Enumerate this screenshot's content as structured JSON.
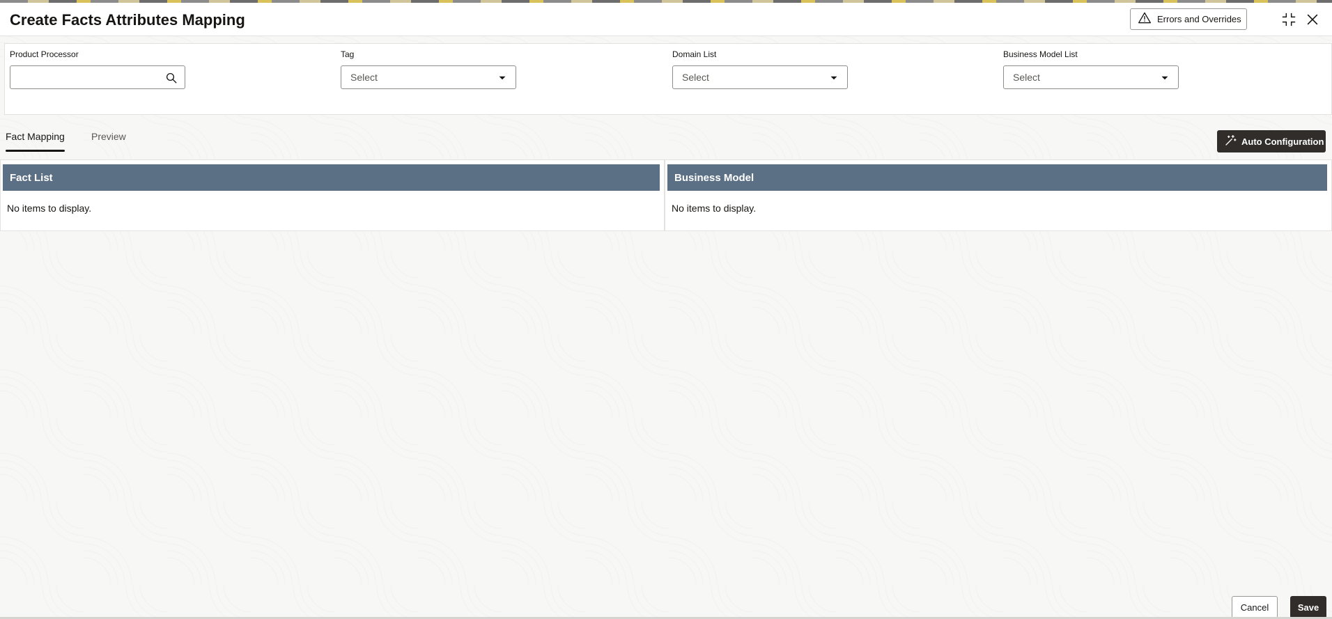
{
  "header": {
    "title": "Create Facts Attributes Mapping",
    "errors_label": "Errors and Overrides"
  },
  "filters": {
    "product_processor": {
      "label": "Product Processor",
      "value": ""
    },
    "tag": {
      "label": "Tag",
      "value": "Select"
    },
    "domain_list": {
      "label": "Domain List",
      "value": "Select"
    },
    "business_model_list": {
      "label": "Business Model List",
      "value": "Select"
    }
  },
  "tabs": [
    {
      "label": "Fact Mapping",
      "active": true
    },
    {
      "label": "Preview",
      "active": false
    }
  ],
  "toolbar": {
    "auto_config_label": "Auto Configuration"
  },
  "panels": {
    "fact_list": {
      "title": "Fact List",
      "empty_text": "No items to display."
    },
    "business_model": {
      "title": "Business Model",
      "empty_text": "No items to display."
    }
  },
  "footer": {
    "cancel_label": "Cancel",
    "save_label": "Save"
  },
  "colors": {
    "panel_header": "#5b6f85",
    "primary_button": "#312d2a"
  }
}
